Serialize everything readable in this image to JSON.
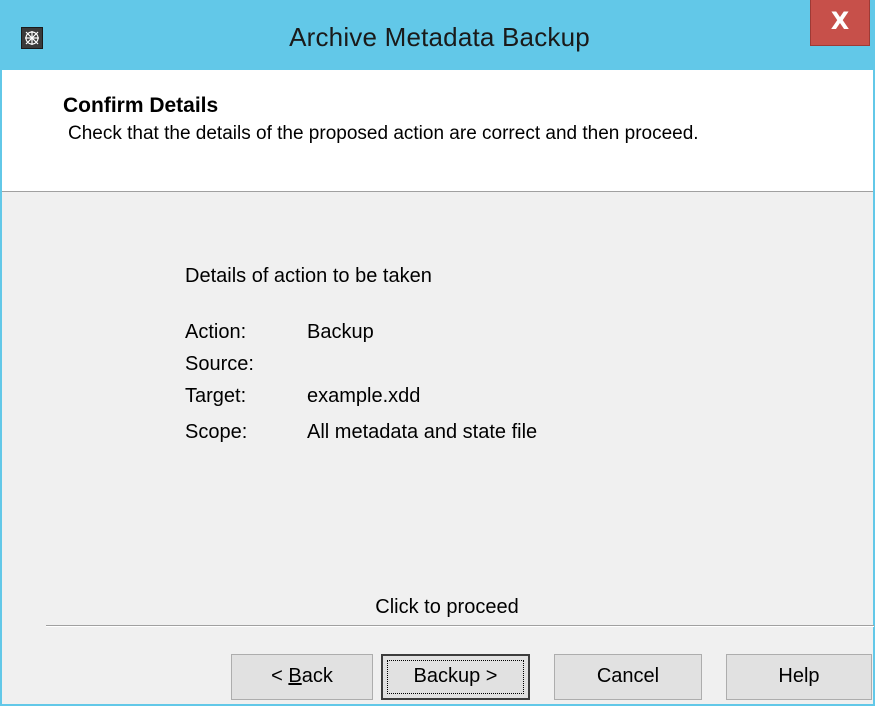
{
  "window": {
    "title": "Archive Metadata Backup",
    "close_glyph": "X",
    "icon": "app-grid-icon"
  },
  "header": {
    "title": "Confirm Details",
    "description": "Check that the details of the proposed action are correct and then proceed."
  },
  "details": {
    "heading": "Details of action to be taken",
    "rows": [
      {
        "label": "Action:",
        "value": "Backup"
      },
      {
        "label": "Source:",
        "value": ""
      },
      {
        "label": "Target:",
        "value": "example.xdd"
      },
      {
        "label": "Scope:",
        "value": "All metadata and state file"
      }
    ]
  },
  "footer": {
    "proceed_text": "Click to proceed"
  },
  "buttons": {
    "back_prefix": "< ",
    "back_mnemonic": "B",
    "back_rest": "ack",
    "backup": "Backup >",
    "cancel": "Cancel",
    "help": "Help"
  },
  "colors": {
    "titlebar": "#62c8e8",
    "close_button": "#c7504a",
    "dialog_background": "#f0f0f0",
    "header_background": "#ffffff"
  }
}
